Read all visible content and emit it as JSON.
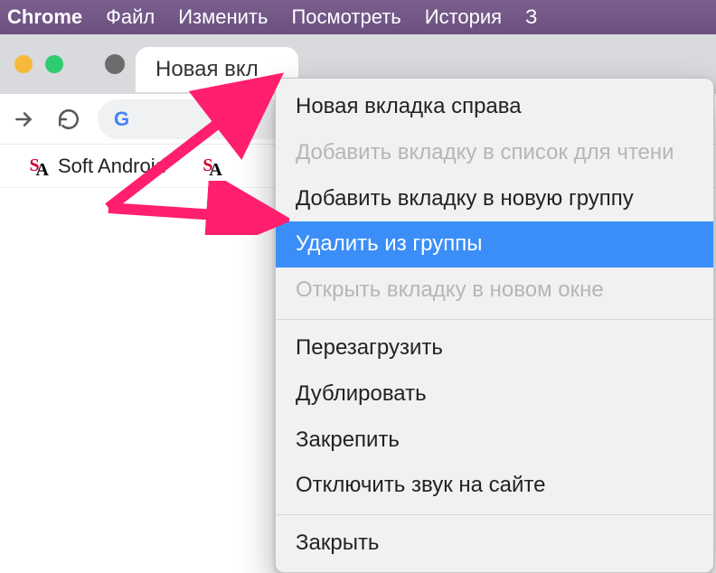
{
  "menubar": {
    "app": "Chrome",
    "items": [
      "Файл",
      "Изменить",
      "Посмотреть",
      "История",
      "З"
    ]
  },
  "tab": {
    "title": "Новая вкл"
  },
  "bookmarks": {
    "items": [
      {
        "label": "Soft Android"
      }
    ]
  },
  "context_menu": {
    "groups": [
      [
        {
          "label": "Новая вкладка справа",
          "enabled": true
        },
        {
          "label": "Добавить вкладку в список для чтени",
          "enabled": false
        },
        {
          "label": "Добавить вкладку в новую группу",
          "enabled": true
        },
        {
          "label": "Удалить из группы",
          "enabled": true,
          "highlighted": true
        },
        {
          "label": "Открыть вкладку в новом окне",
          "enabled": false
        }
      ],
      [
        {
          "label": "Перезагрузить",
          "enabled": true
        },
        {
          "label": "Дублировать",
          "enabled": true
        },
        {
          "label": "Закрепить",
          "enabled": true
        },
        {
          "label": "Отключить звук на сайте",
          "enabled": true
        }
      ],
      [
        {
          "label": "Закрыть",
          "enabled": true
        }
      ]
    ]
  }
}
